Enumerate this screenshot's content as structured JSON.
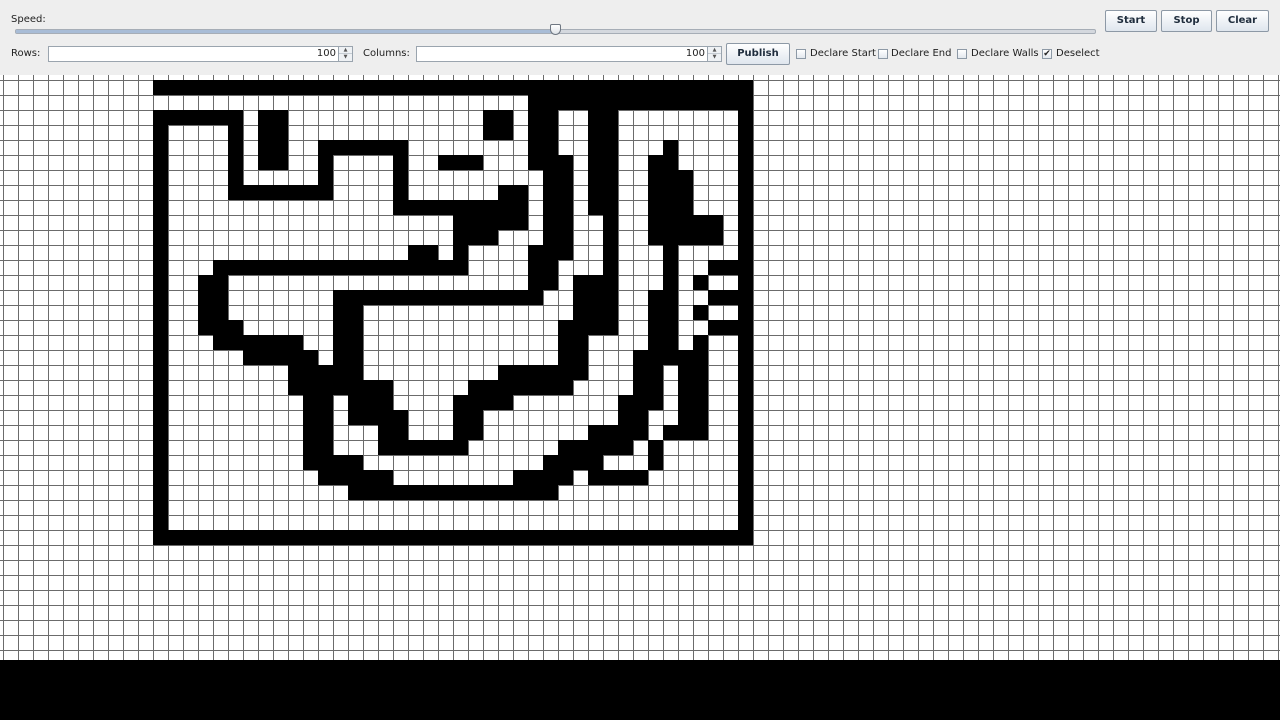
{
  "controls": {
    "speed_label": "Speed:",
    "speed_value": 0.5,
    "rows_label": "Rows:",
    "rows_value": "100",
    "columns_label": "Columns:",
    "columns_value": "100",
    "publish_label": "Publish",
    "start_label": "Start",
    "stop_label": "Stop",
    "clear_label": "Clear",
    "declare_start_label": "Declare Start",
    "declare_start_checked": false,
    "declare_end_label": "Declare End",
    "declare_end_checked": false,
    "declare_walls_label": "Declare Walls",
    "declare_walls_checked": false,
    "deselect_label": "Deselect",
    "deselect_checked": true
  },
  "grid": {
    "line_color": "#6b6b6b",
    "empty_color": "#ffffff",
    "wall_color": "#000000"
  }
}
